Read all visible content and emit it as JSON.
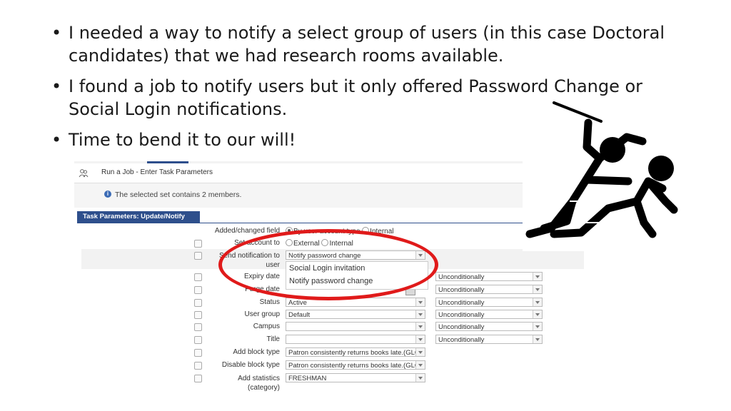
{
  "bullets": [
    "I needed a way to notify a select group of users (in this case Doctoral candidates) that we had research rooms available.",
    "I found a job to notify users but it only offered Password Change or Social Login notifications.",
    "Time to bend it to our will!"
  ],
  "screenshot": {
    "header_title": "Run a Job - Enter Task Parameters",
    "info_message": "The selected set contains 2 members.",
    "section_title": "Task Parameters: Update/Notify Users",
    "fields": {
      "added_changed": {
        "label": "Added/changed field",
        "opt1": "By user account type",
        "opt2": "Internal"
      },
      "set_account": {
        "label": "Set account to",
        "opt1": "External",
        "opt2": "Internal"
      },
      "send_notification": {
        "label": "Send notification to user",
        "value": "Notify password change"
      },
      "expiry_date": {
        "label": "Expiry date",
        "condition": "Unconditionally"
      },
      "purge_date": {
        "label": "Purge date",
        "condition": "Unconditionally"
      },
      "status": {
        "label": "Status",
        "value": "Active",
        "condition": "Unconditionally"
      },
      "user_group": {
        "label": "User group",
        "value": "Default",
        "condition": "Unconditionally"
      },
      "campus": {
        "label": "Campus",
        "value": "",
        "condition": "Unconditionally"
      },
      "title": {
        "label": "Title",
        "value": "",
        "condition": "Unconditionally"
      },
      "add_block_type": {
        "label": "Add block type",
        "value": "Patron consistently returns books late.(GLOI"
      },
      "disable_block_type": {
        "label": "Disable block type",
        "value": "Patron consistently returns books late.(GLOI"
      },
      "add_statistics": {
        "label": "Add statistics (category)",
        "value": "FRESHMAN"
      }
    },
    "dropdown_options": [
      "Social Login invitation",
      "Notify password change"
    ]
  },
  "colors": {
    "accent": "#2e4f8c",
    "highlight_ring": "#e01a1a"
  }
}
